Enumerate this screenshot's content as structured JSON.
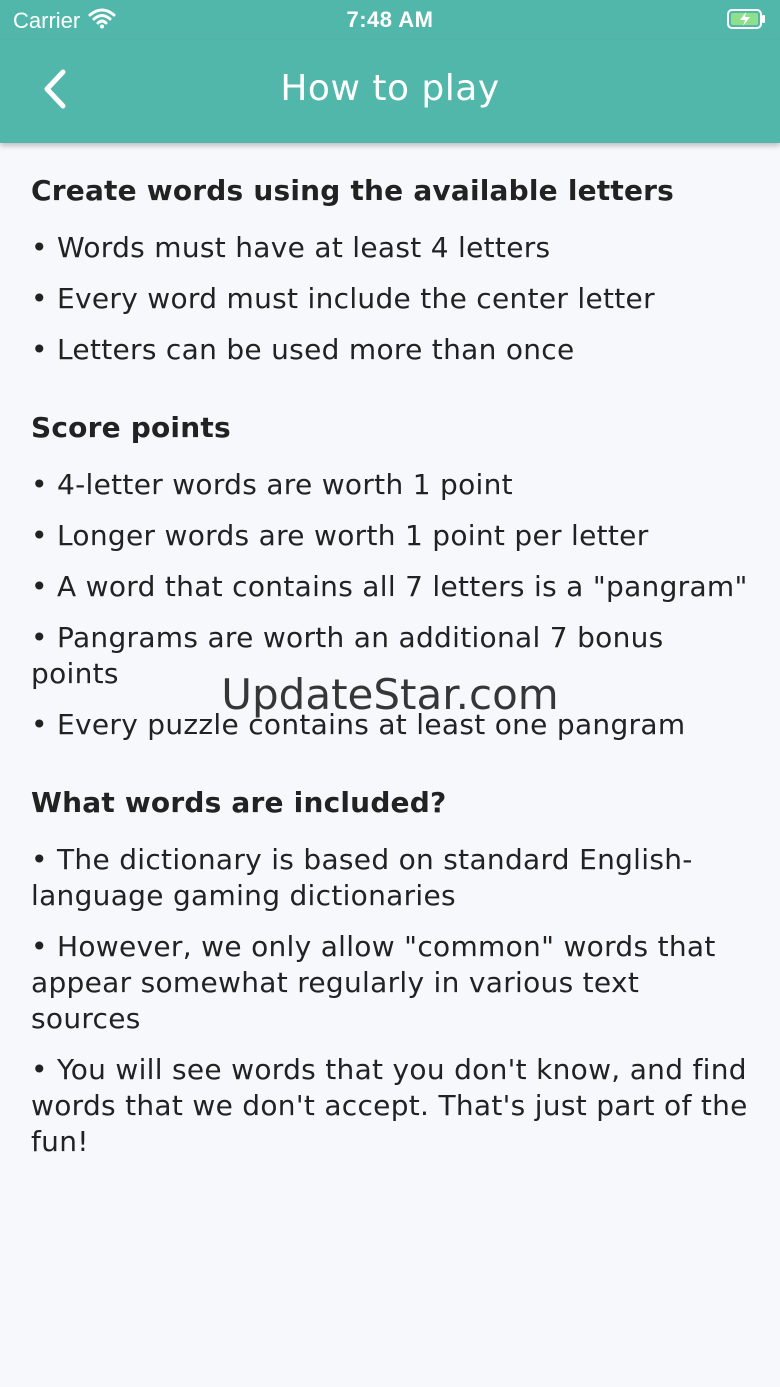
{
  "status_bar": {
    "carrier": "Carrier",
    "time": "7:48 AM",
    "icons": [
      "wifi-icon",
      "battery-charging-icon"
    ]
  },
  "app_bar": {
    "title": "How to play",
    "back_icon": "chevron-left-icon",
    "background_color": "#52b7ab"
  },
  "sections": [
    {
      "title": "Create words using the available letters",
      "items": [
        "• Words must have at least 4 letters",
        "• Every word must include the center letter",
        "• Letters can be used more than once"
      ]
    },
    {
      "title": "Score points",
      "items": [
        "• 4-letter words are worth 1 point",
        "• Longer words are worth 1 point per letter",
        "• A word that contains all 7 letters is a \"pangram\"",
        "• Pangrams are worth an additional 7 bonus points",
        "• Every puzzle contains at least one pangram"
      ]
    },
    {
      "title": "What words are included?",
      "items": [
        "• The dictionary is based on standard English-language gaming dictionaries",
        "• However, we only allow \"common\" words that appear somewhat regularly in various text sources",
        "• You will see words that you don't know, and find words that we don't accept. That's just part of the fun!"
      ]
    }
  ],
  "watermark": "UpdateStar.com"
}
